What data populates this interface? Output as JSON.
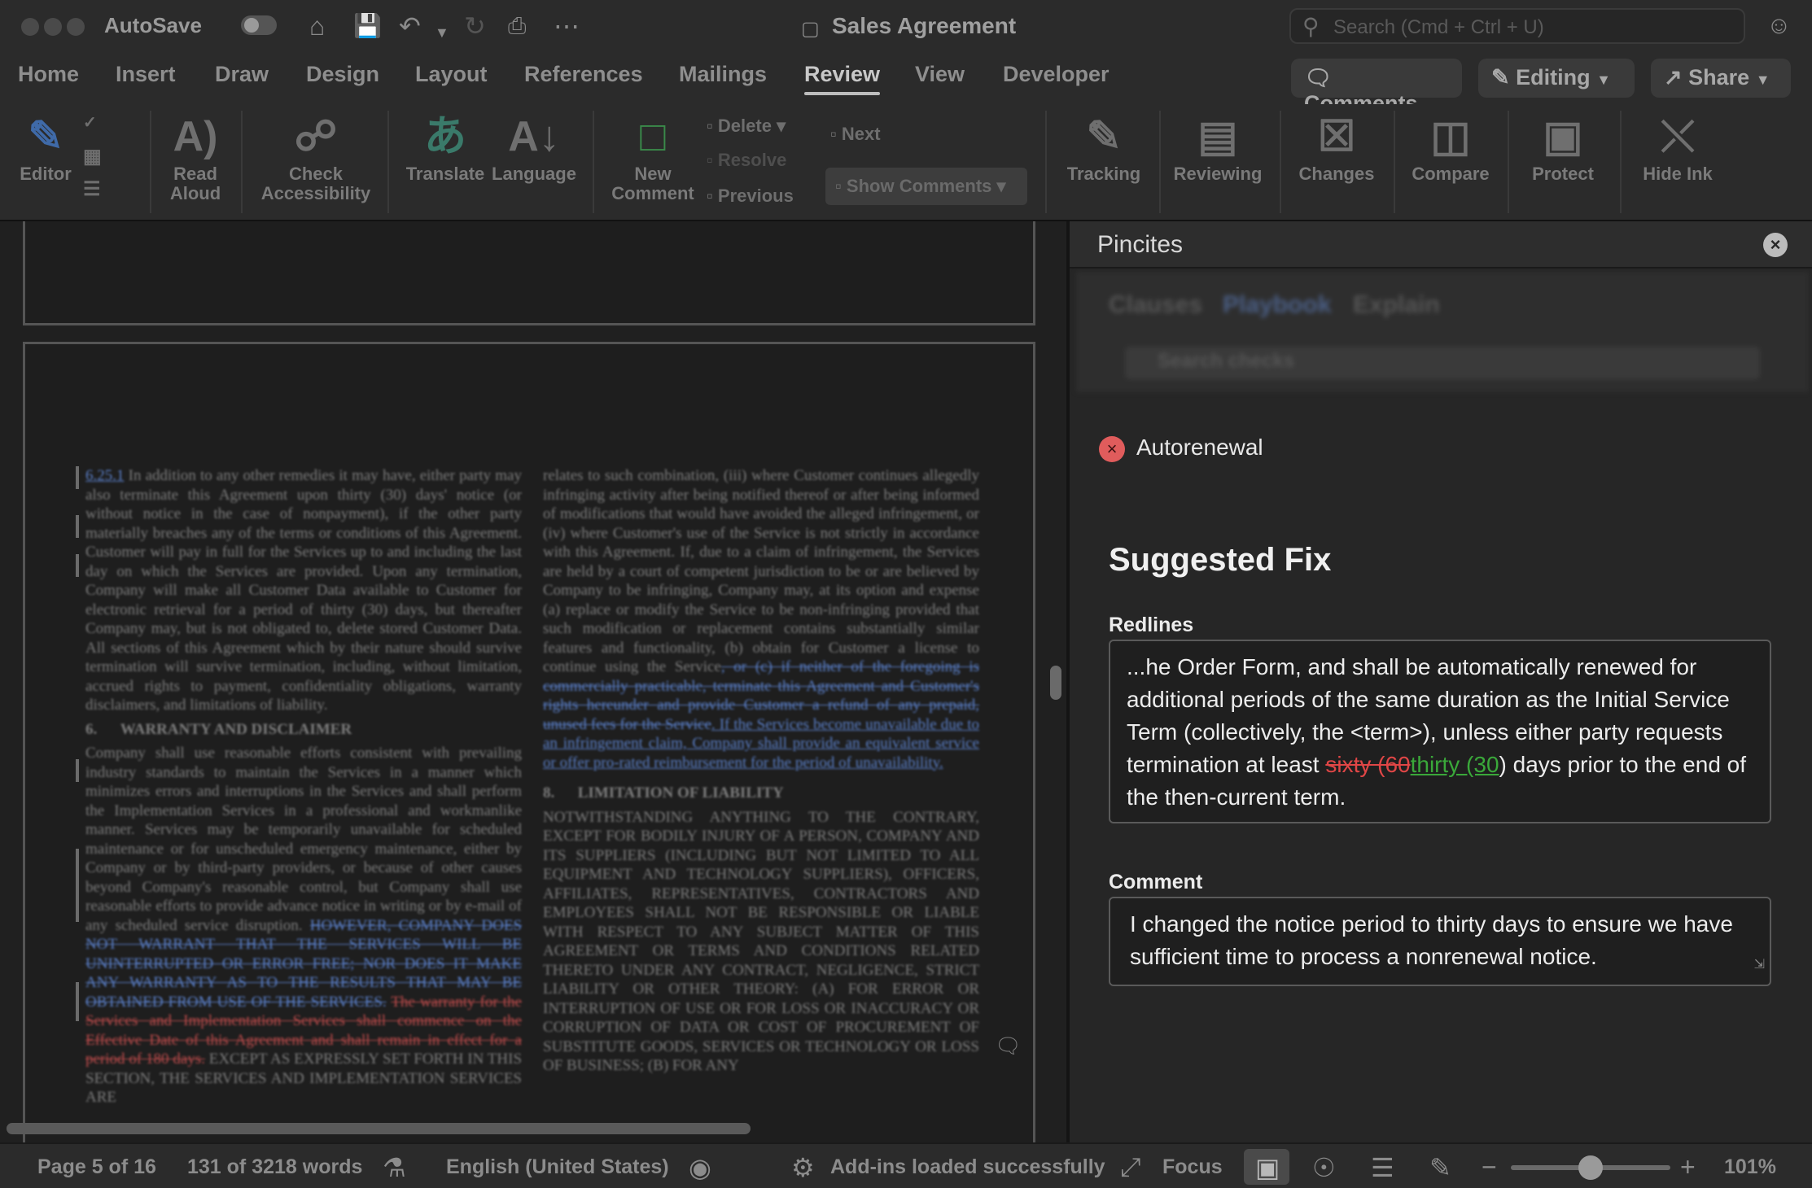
{
  "titlebar": {
    "autosave_label": "AutoSave",
    "doc_title": "Sales Agreement",
    "search_placeholder": "Search (Cmd + Ctrl + U)"
  },
  "tabs": [
    "Home",
    "Insert",
    "Draw",
    "Design",
    "Layout",
    "References",
    "Mailings",
    "Review",
    "View",
    "Developer"
  ],
  "active_tab": "Review",
  "top_buttons": {
    "comments": "Comments",
    "editing": "Editing",
    "share": "Share"
  },
  "ribbon": {
    "editor": "Editor",
    "read_aloud_1": "Read",
    "read_aloud_2": "Aloud",
    "check_1": "Check",
    "check_2": "Accessibility",
    "translate": "Translate",
    "language": "Language",
    "new_comment_1": "New",
    "new_comment_2": "Comment",
    "delete": "Delete",
    "resolve": "Resolve",
    "previous": "Previous",
    "next": "Next",
    "show_comments": "Show Comments",
    "tracking": "Tracking",
    "reviewing": "Reviewing",
    "changes": "Changes",
    "compare": "Compare",
    "protect": "Protect",
    "hide_ink": "Hide Ink"
  },
  "document": {
    "col1_clause": "6.25.1",
    "col1_text": "In addition to any other remedies it may have, either party may also terminate this Agreement upon thirty (30) days' notice (or without notice in the case of nonpayment), if the other party materially breaches any of the terms or conditions of this Agreement. Customer will pay in full for the Services up to and including the last day on which the Services are provided. Upon any termination, Company will make all Customer Data available to Customer for electronic retrieval for a period of thirty (30) days, but thereafter Company may, but is not obligated to, delete stored Customer Data. All sections of this Agreement which by their nature should survive termination will survive termination, including, without limitation, accrued rights to payment, confidentiality obligations, warranty disclaimers, and limitations of liability.",
    "sec6_num": "6.",
    "sec6_title": "WARRANTY AND DISCLAIMER",
    "sec6_text": "Company shall use reasonable efforts consistent with prevailing industry standards to maintain the Services in a manner which minimizes errors and interruptions in the Services and shall perform the Implementation Services in a professional and workmanlike manner. Services may be temporarily unavailable for scheduled maintenance or for unscheduled emergency maintenance, either by Company or by third-party providers, or because of other causes beyond Company's reasonable control, but Company shall use reasonable efforts to provide advance notice in writing or by e-mail of any scheduled service disruption.",
    "sec6_blue_del": "HOWEVER, COMPANY DOES NOT WARRANT THAT THE SERVICES WILL BE UNINTERRUPTED OR ERROR FREE; NOR DOES IT MAKE ANY WARRANTY AS TO THE RESULTS THAT MAY BE OBTAINED FROM USE OF THE SERVICES.",
    "sec6_red_del": "The warranty for the Services and Implementation Services shall commence on the Effective Date of this Agreement and shall remain in effect for a period of 180 days.",
    "sec6_tail": "EXCEPT AS EXPRESSLY SET FORTH IN THIS SECTION, THE SERVICES AND IMPLEMENTATION SERVICES ARE",
    "col2_text": "relates to such combination, (iii) where Customer continues allegedly infringing activity after being notified thereof or after being informed of modifications that would have avoided the alleged infringement, or (iv) where Customer's use of the Service is not strictly in accordance with this Agreement. If, due to a claim of infringement, the Services are held by a court of competent jurisdiction to be or are believed by Company to be infringing, Company may, at its option and expense (a) replace or modify the Service to be non-infringing provided that such modification or replacement contains substantially similar features and functionality, (b) obtain for Customer a license to continue using the Service",
    "col2_blue_del": ", or (c) if neither of the foregoing is commercially practicable, terminate this Agreement and Customer's rights hereunder and provide Customer a refund of any prepaid, unused fees for the Service",
    "col2_blue_ins": ". If the Services become unavailable due to an infringement claim, Company shall provide an equivalent service or offer pro-rated reimbursement for the period of unavailability.",
    "sec8_num": "8.",
    "sec8_title": "LIMITATION OF LIABILITY",
    "sec8_text": "NOTWITHSTANDING ANYTHING TO THE CONTRARY, EXCEPT FOR BODILY INJURY OF A PERSON, COMPANY AND ITS SUPPLIERS (INCLUDING BUT NOT LIMITED TO ALL EQUIPMENT AND TECHNOLOGY SUPPLIERS), OFFICERS, AFFILIATES, REPRESENTATIVES, CONTRACTORS AND EMPLOYEES SHALL NOT BE RESPONSIBLE OR LIABLE WITH RESPECT TO ANY SUBJECT MATTER OF THIS AGREEMENT OR TERMS AND CONDITIONS RELATED THERETO UNDER ANY CONTRACT, NEGLIGENCE, STRICT LIABILITY OR OTHER THEORY: (A) FOR ERROR OR INTERRUPTION OF USE OR FOR LOSS OR INACCURACY OR CORRUPTION OF DATA OR COST OF PROCUREMENT OF SUBSTITUTE GOODS, SERVICES OR TECHNOLOGY OR LOSS OF BUSINESS; (B) FOR ANY"
  },
  "pane": {
    "title": "Pincites",
    "blurred_tabs": [
      "Clauses",
      "Playbook",
      "Explain"
    ],
    "blurred_search": "Search checks",
    "issue": "Autorenewal",
    "heading": "Suggested Fix",
    "redlines_label": "Redlines",
    "redline_before": "...he Order Form, and shall be automatically renewed for additional periods of the same duration as the Initial Service Term (collectively, the <term>), unless either party requests termination at least ",
    "redline_deleted": "sixty (60",
    "redline_inserted": "thirty (30",
    "redline_after": ") days prior to the end of the then-current term.",
    "comment_label": "Comment",
    "comment_text": "I changed the notice period to thirty days to ensure we have sufficient time to process a nonrenewal notice.",
    "colors": {
      "deleted": "#e04646",
      "inserted": "#3aa83a",
      "issue_icon": "#e05c5c"
    }
  },
  "statusbar": {
    "page": "Page 5 of 16",
    "words": "131 of 3218 words",
    "language": "English (United States)",
    "addins": "Add-ins loaded successfully",
    "focus": "Focus",
    "zoom": "101%",
    "zoom_percent": 101
  }
}
